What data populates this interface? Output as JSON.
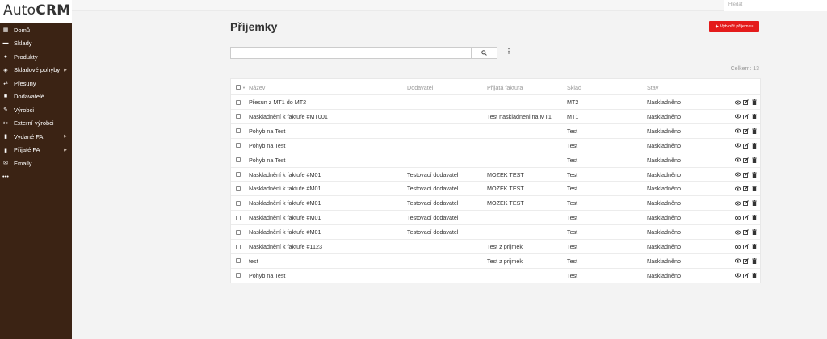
{
  "app": {
    "logo_light": "Auto",
    "logo_bold": "CRM"
  },
  "topbar": {
    "search_placeholder": "Hledat"
  },
  "sidebar": {
    "items": [
      {
        "label": "Domů",
        "icon": "grid-icon",
        "caret": false
      },
      {
        "label": "Sklady",
        "icon": "warehouse-icon",
        "caret": false
      },
      {
        "label": "Produkty",
        "icon": "product-icon",
        "caret": false
      },
      {
        "label": "Skladové pohyby",
        "icon": "layers-icon",
        "caret": true
      },
      {
        "label": "Přesuny",
        "icon": "transfer-icon",
        "caret": false
      },
      {
        "label": "Dodavatelé",
        "icon": "truck-icon",
        "caret": false
      },
      {
        "label": "Výrobci",
        "icon": "wrench-icon",
        "caret": false
      },
      {
        "label": "Externí výrobci",
        "icon": "tools-icon",
        "caret": false
      },
      {
        "label": "Vydané FA",
        "icon": "document-icon",
        "caret": true
      },
      {
        "label": "Přijaté FA",
        "icon": "document-icon",
        "caret": true
      },
      {
        "label": "Emaily",
        "icon": "envelope-icon",
        "caret": false
      },
      {
        "label": "•••",
        "icon": "",
        "caret": false
      }
    ]
  },
  "page": {
    "title": "Příjemky",
    "create_button": "Vytvořit příjemku",
    "total": "Celkem: 13"
  },
  "table": {
    "headers": {
      "name": "Název",
      "supplier": "Dodavatel",
      "invoice": "Přijatá faktura",
      "warehouse": "Sklad",
      "state": "Stav"
    },
    "rows": [
      {
        "name": "Přesun z MT1 do MT2",
        "supplier": "",
        "invoice": "",
        "warehouse": "MT2",
        "state": "Naskladněno"
      },
      {
        "name": "Naskladnění k faktuře #MT001",
        "supplier": "",
        "invoice": "Test naskladneni na MT1",
        "warehouse": "MT1",
        "state": "Naskladněno"
      },
      {
        "name": "Pohyb na Test",
        "supplier": "",
        "invoice": "",
        "warehouse": "Test",
        "state": "Naskladněno"
      },
      {
        "name": "Pohyb na Test",
        "supplier": "",
        "invoice": "",
        "warehouse": "Test",
        "state": "Naskladněno"
      },
      {
        "name": "Pohyb na Test",
        "supplier": "",
        "invoice": "",
        "warehouse": "Test",
        "state": "Naskladněno"
      },
      {
        "name": "Naskladnění k faktuře #M01",
        "supplier": "Testovací dodavatel",
        "invoice": "MOZEK TEST",
        "warehouse": "Test",
        "state": "Naskladněno"
      },
      {
        "name": "Naskladnění k faktuře #M01",
        "supplier": "Testovací dodavatel",
        "invoice": "MOZEK TEST",
        "warehouse": "Test",
        "state": "Naskladněno"
      },
      {
        "name": "Naskladnění k faktuře #M01",
        "supplier": "Testovací dodavatel",
        "invoice": "MOZEK TEST",
        "warehouse": "Test",
        "state": "Naskladněno"
      },
      {
        "name": "Naskladnění k faktuře #M01",
        "supplier": "Testovací dodavatel",
        "invoice": "",
        "warehouse": "Test",
        "state": "Naskladněno"
      },
      {
        "name": "Naskladnění k faktuře #M01",
        "supplier": "Testovací dodavatel",
        "invoice": "",
        "warehouse": "Test",
        "state": "Naskladněno"
      },
      {
        "name": "Naskladnění k faktuře #1123",
        "supplier": "",
        "invoice": "Test z prijmek",
        "warehouse": "Test",
        "state": "Naskladněno"
      },
      {
        "name": "test",
        "supplier": "",
        "invoice": "Test z prijmek",
        "warehouse": "Test",
        "state": "Naskladněno"
      },
      {
        "name": "Pohyb na Test",
        "supplier": "",
        "invoice": "",
        "warehouse": "Test",
        "state": "Naskladněno"
      }
    ]
  }
}
